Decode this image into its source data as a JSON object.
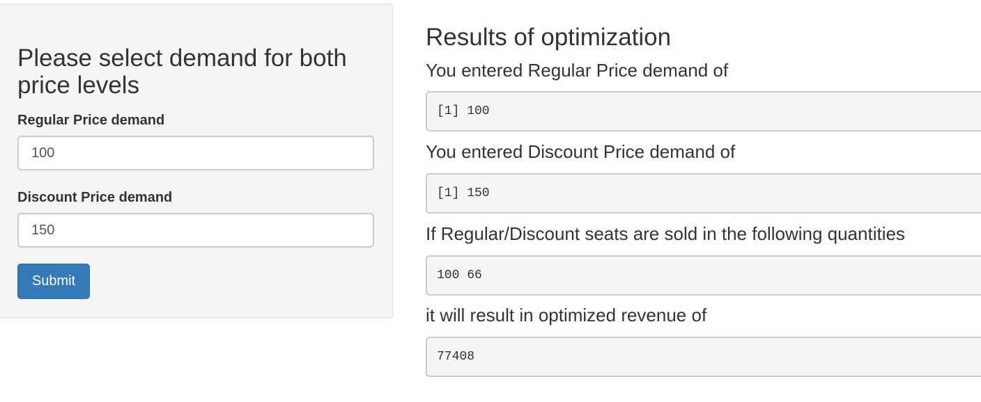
{
  "sidebar": {
    "title": "Please select demand for both price levels",
    "regular": {
      "label": "Regular Price demand",
      "value": "100"
    },
    "discount": {
      "label": "Discount Price demand",
      "value": "150"
    },
    "submit_label": "Submit"
  },
  "main": {
    "title": "Results of optimization",
    "results": [
      {
        "label": "You entered Regular Price demand of",
        "output": "[1] 100"
      },
      {
        "label": "You entered Discount Price demand of",
        "output": "[1] 150"
      },
      {
        "label": "If Regular/Discount seats are sold in the following quantities",
        "output": "100 66"
      },
      {
        "label": "it will result in optimized revenue of",
        "output": "77408"
      }
    ]
  },
  "colors": {
    "primary_button": "#337ab7",
    "panel_background": "#f5f5f5",
    "border": "#cccccc",
    "text": "#333333"
  }
}
